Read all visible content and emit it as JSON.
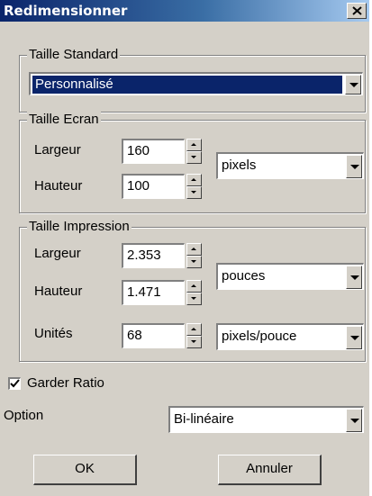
{
  "window": {
    "title": "Redimensionner",
    "close_label": "X"
  },
  "taille_standard": {
    "legend": "Taille Standard",
    "selected": "Personnalisé"
  },
  "taille_ecran": {
    "legend": "Taille Ecran",
    "largeur_label": "Largeur",
    "largeur_value": "160",
    "hauteur_label": "Hauteur",
    "hauteur_value": "100",
    "unit": "pixels"
  },
  "taille_impression": {
    "legend": "Taille Impression",
    "largeur_label": "Largeur",
    "largeur_value": "2.353",
    "hauteur_label": "Hauteur",
    "hauteur_value": "1.471",
    "unit": "pouces",
    "unites_label": "Unités",
    "unites_value": "68",
    "resolution_unit": "pixels/pouce"
  },
  "garder_ratio": {
    "label": "Garder Ratio",
    "checked": true
  },
  "option": {
    "label": "Option",
    "selected": "Bi-linéaire"
  },
  "buttons": {
    "ok": "OK",
    "cancel": "Annuler"
  }
}
